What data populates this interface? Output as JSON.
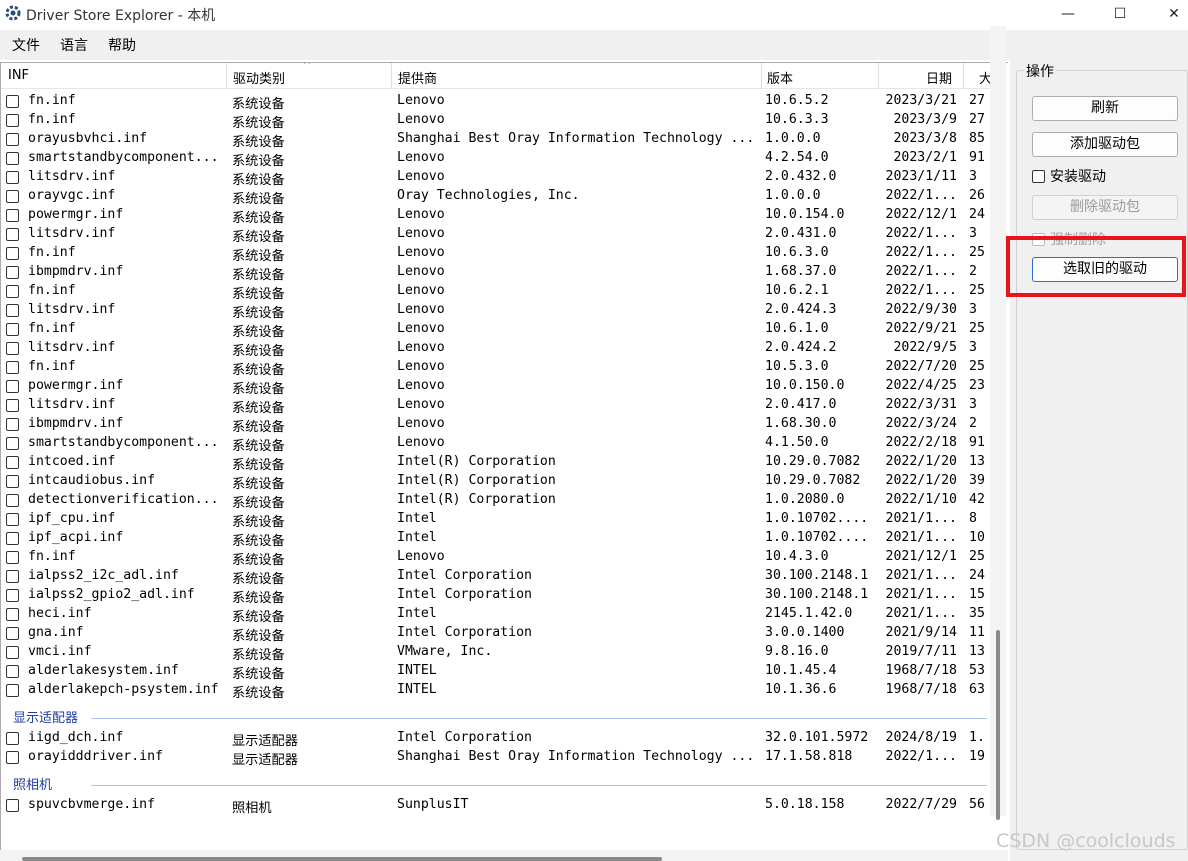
{
  "window": {
    "title": "Driver Store Explorer - 本机",
    "minimize": "—",
    "maximize": "☐",
    "close": "✕"
  },
  "menu": [
    "文件",
    "语言",
    "帮助"
  ],
  "columns": {
    "inf": "INF",
    "type": "驱动类别",
    "provider": "提供商",
    "version": "版本",
    "date": "日期",
    "size": "大"
  },
  "rows": [
    {
      "inf": "fn.inf",
      "type": "系统设备",
      "provider": "Lenovo",
      "version": "10.6.5.2",
      "date": "2023/3/21",
      "size": "27"
    },
    {
      "inf": "fn.inf",
      "type": "系统设备",
      "provider": "Lenovo",
      "version": "10.6.3.3",
      "date": "2023/3/9",
      "size": "27"
    },
    {
      "inf": "orayusbvhci.inf",
      "type": "系统设备",
      "provider": "Shanghai Best Oray Information Technology ...",
      "version": "1.0.0.0",
      "date": "2023/3/8",
      "size": "85"
    },
    {
      "inf": "smartstandbycomponent...",
      "type": "系统设备",
      "provider": "Lenovo",
      "version": "4.2.54.0",
      "date": "2023/2/1",
      "size": "91"
    },
    {
      "inf": "litsdrv.inf",
      "type": "系统设备",
      "provider": "Lenovo",
      "version": "2.0.432.0",
      "date": "2023/1/11",
      "size": "3"
    },
    {
      "inf": "orayvgc.inf",
      "type": "系统设备",
      "provider": "Oray Technologies, Inc.",
      "version": "1.0.0.0",
      "date": "2022/1...",
      "size": "26"
    },
    {
      "inf": "powermgr.inf",
      "type": "系统设备",
      "provider": "Lenovo",
      "version": "10.0.154.0",
      "date": "2022/12/1",
      "size": "24"
    },
    {
      "inf": "litsdrv.inf",
      "type": "系统设备",
      "provider": "Lenovo",
      "version": "2.0.431.0",
      "date": "2022/1...",
      "size": "3"
    },
    {
      "inf": "fn.inf",
      "type": "系统设备",
      "provider": "Lenovo",
      "version": "10.6.3.0",
      "date": "2022/1...",
      "size": "25"
    },
    {
      "inf": "ibmpmdrv.inf",
      "type": "系统设备",
      "provider": "Lenovo",
      "version": "1.68.37.0",
      "date": "2022/1...",
      "size": "2"
    },
    {
      "inf": "fn.inf",
      "type": "系统设备",
      "provider": "Lenovo",
      "version": "10.6.2.1",
      "date": "2022/1...",
      "size": "25"
    },
    {
      "inf": "litsdrv.inf",
      "type": "系统设备",
      "provider": "Lenovo",
      "version": "2.0.424.3",
      "date": "2022/9/30",
      "size": "3"
    },
    {
      "inf": "fn.inf",
      "type": "系统设备",
      "provider": "Lenovo",
      "version": "10.6.1.0",
      "date": "2022/9/21",
      "size": "25"
    },
    {
      "inf": "litsdrv.inf",
      "type": "系统设备",
      "provider": "Lenovo",
      "version": "2.0.424.2",
      "date": "2022/9/5",
      "size": "3"
    },
    {
      "inf": "fn.inf",
      "type": "系统设备",
      "provider": "Lenovo",
      "version": "10.5.3.0",
      "date": "2022/7/20",
      "size": "25"
    },
    {
      "inf": "powermgr.inf",
      "type": "系统设备",
      "provider": "Lenovo",
      "version": "10.0.150.0",
      "date": "2022/4/25",
      "size": "23"
    },
    {
      "inf": "litsdrv.inf",
      "type": "系统设备",
      "provider": "Lenovo",
      "version": "2.0.417.0",
      "date": "2022/3/31",
      "size": "3"
    },
    {
      "inf": "ibmpmdrv.inf",
      "type": "系统设备",
      "provider": "Lenovo",
      "version": "1.68.30.0",
      "date": "2022/3/24",
      "size": "2"
    },
    {
      "inf": "smartstandbycomponent...",
      "type": "系统设备",
      "provider": "Lenovo",
      "version": "4.1.50.0",
      "date": "2022/2/18",
      "size": "91"
    },
    {
      "inf": "intcoed.inf",
      "type": "系统设备",
      "provider": "Intel(R) Corporation",
      "version": "10.29.0.7082",
      "date": "2022/1/20",
      "size": "13"
    },
    {
      "inf": "intcaudiobus.inf",
      "type": "系统设备",
      "provider": "Intel(R) Corporation",
      "version": "10.29.0.7082",
      "date": "2022/1/20",
      "size": "39"
    },
    {
      "inf": "detectionverification...",
      "type": "系统设备",
      "provider": "Intel(R) Corporation",
      "version": "1.0.2080.0",
      "date": "2022/1/10",
      "size": "42"
    },
    {
      "inf": "ipf_cpu.inf",
      "type": "系统设备",
      "provider": "Intel",
      "version": "1.0.10702....",
      "date": "2021/1...",
      "size": "8"
    },
    {
      "inf": "ipf_acpi.inf",
      "type": "系统设备",
      "provider": "Intel",
      "version": "1.0.10702....",
      "date": "2021/1...",
      "size": "10"
    },
    {
      "inf": "fn.inf",
      "type": "系统设备",
      "provider": "Lenovo",
      "version": "10.4.3.0",
      "date": "2021/12/1",
      "size": "25"
    },
    {
      "inf": "ialpss2_i2c_adl.inf",
      "type": "系统设备",
      "provider": "Intel Corporation",
      "version": "30.100.2148.1",
      "date": "2021/1...",
      "size": "24"
    },
    {
      "inf": "ialpss2_gpio2_adl.inf",
      "type": "系统设备",
      "provider": "Intel Corporation",
      "version": "30.100.2148.1",
      "date": "2021/1...",
      "size": "15"
    },
    {
      "inf": "heci.inf",
      "type": "系统设备",
      "provider": "Intel",
      "version": "2145.1.42.0",
      "date": "2021/1...",
      "size": "35"
    },
    {
      "inf": "gna.inf",
      "type": "系统设备",
      "provider": "Intel Corporation",
      "version": "3.0.0.1400",
      "date": "2021/9/14",
      "size": "11"
    },
    {
      "inf": "vmci.inf",
      "type": "系统设备",
      "provider": "VMware, Inc.",
      "version": "9.8.16.0",
      "date": "2019/7/11",
      "size": "13"
    },
    {
      "inf": "alderlakesystem.inf",
      "type": "系统设备",
      "provider": "INTEL",
      "version": "10.1.45.4",
      "date": "1968/7/18",
      "size": "53"
    },
    {
      "inf": "alderlakepch-psystem.inf",
      "type": "系统设备",
      "provider": "INTEL",
      "version": "10.1.36.6",
      "date": "1968/7/18",
      "size": "63"
    }
  ],
  "groups": [
    {
      "label": "显示适配器",
      "rows": [
        {
          "inf": "iigd_dch.inf",
          "type": "显示适配器",
          "provider": "Intel Corporation",
          "version": "32.0.101.5972",
          "date": "2024/8/19",
          "size": "1."
        },
        {
          "inf": "orayidddriver.inf",
          "type": "显示适配器",
          "provider": "Shanghai Best Oray Information Technology ...",
          "version": "17.1.58.818",
          "date": "2022/1...",
          "size": "19"
        }
      ]
    },
    {
      "label": "照相机",
      "rows": [
        {
          "inf": "spuvcbvmerge.inf",
          "type": "照相机",
          "provider": "SunplusIT",
          "version": "5.0.18.158",
          "date": "2022/7/29",
          "size": "56"
        }
      ]
    }
  ],
  "panel": {
    "title": "操作",
    "refresh": "刷新",
    "add_package": "添加驱动包",
    "install_driver": "安装驱动",
    "delete_package": "删除驱动包",
    "force_delete": "强制删除",
    "select_old": "选取旧的驱动"
  },
  "watermark": "CSDN @coolclouds",
  "colors": {
    "highlight": "#e8141c",
    "group_label": "#1e3ca0"
  }
}
